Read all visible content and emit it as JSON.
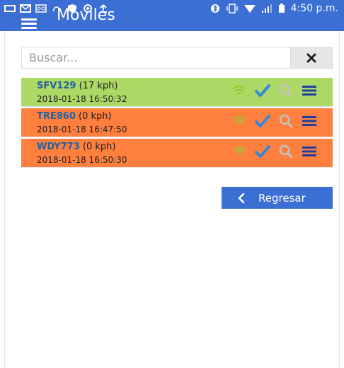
{
  "status_bar": {
    "time": "4:50 p.m."
  },
  "header": {
    "title": "Moviles"
  },
  "search": {
    "placeholder": "Buscar...",
    "value": ""
  },
  "vehicles": [
    {
      "plate": "SFV129",
      "speed": "(17 kph)",
      "timestamp": "2018-01-18 16:50:32",
      "row_color": "#acd866",
      "wifi_color": "#9ac82b"
    },
    {
      "plate": "TRE860",
      "speed": "(0 kph)",
      "timestamp": "2018-01-18 16:47:50",
      "row_color": "#ff7f3e",
      "wifi_color": "#9ac82b"
    },
    {
      "plate": "WDY773",
      "speed": "(0 kph)",
      "timestamp": "2018-01-18 16:50:30",
      "row_color": "#ff7f3e",
      "wifi_color": "#9ac82b"
    }
  ],
  "icons": {
    "signal": "wifi-icon",
    "check": "check-icon",
    "search": "search-icon",
    "menu": "list-icon"
  },
  "colors": {
    "accent": "#3b6fd3",
    "check": "#2f8ad9",
    "search_icon": "#c3c3c3",
    "menu_icon": "#1e3f9f"
  },
  "back_button": {
    "label": "Regresar"
  }
}
